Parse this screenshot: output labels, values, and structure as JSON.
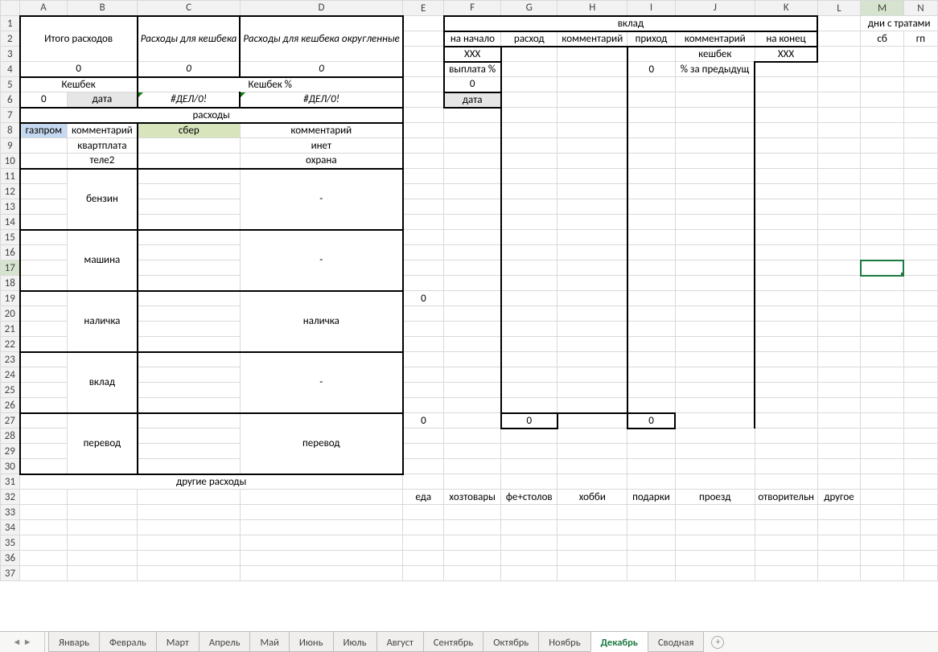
{
  "columns": [
    "A",
    "B",
    "C",
    "D",
    "E",
    "F",
    "G",
    "H",
    "I",
    "J",
    "K",
    "L",
    "M",
    "N"
  ],
  "rows": 37,
  "selected": {
    "col": "M",
    "row": 17
  },
  "cells": {
    "r1": {
      "AB": "Итого расходов",
      "C": "Расходы для кешбека",
      "D": "Расходы для кешбека округленные",
      "H": "вклад",
      "MN": "дни с тратами"
    },
    "r2": {
      "F": "на начало",
      "G": "расход",
      "H": "комментарий",
      "I": "приход",
      "J": "комментарий",
      "K": "на конец",
      "M": "сб",
      "N": "гп"
    },
    "r3": {
      "F": "XXX",
      "J": "кешбек",
      "K": "XXX"
    },
    "r4": {
      "AB": "0",
      "C": "0",
      "D": "0",
      "F": "выплата %",
      "I": "0",
      "J": "% за предыдущ"
    },
    "r5": {
      "AB": "Кешбек",
      "CD": "Кешбек %",
      "F": "0"
    },
    "r6": {
      "A": "0",
      "B": "дата",
      "C": "#ДЕЛ/0!",
      "D": "#ДЕЛ/0!",
      "F": "дата"
    },
    "r7": {
      "AD": "расходы"
    },
    "r8": {
      "A": "газпром",
      "B": "комментарий",
      "C": "сбер",
      "D": "комментарий"
    },
    "r9": {
      "B": "квартплата",
      "D": "инет"
    },
    "r10": {
      "B": "теле2",
      "D": "охрана"
    },
    "r12": {
      "B": "бензин",
      "D": "-"
    },
    "r16": {
      "B": "машина",
      "D": "-"
    },
    "r19": {
      "E": "0"
    },
    "r20": {
      "B": "наличка",
      "D": "наличка"
    },
    "r24": {
      "B": "вклад",
      "D": "-"
    },
    "r27": {
      "E": "0",
      "G": "0",
      "I": "0"
    },
    "r28": {
      "B": "перевод",
      "D": "перевод"
    },
    "r31": {
      "AD": "другие расходы"
    },
    "r32": {
      "E": "еда",
      "F": "хозтовары",
      "G": "фе+столов",
      "H": "хобби",
      "I": "подарки",
      "J": "проезд",
      "K": "отворительн",
      "L": "другое"
    }
  },
  "tabs": [
    "Январь",
    "Февраль",
    "Март",
    "Апрель",
    "Май",
    "Июнь",
    "Июль",
    "Август",
    "Сентябрь",
    "Октябрь",
    "Ноябрь",
    "Декабрь",
    "Сводная"
  ],
  "activeTab": "Декабрь"
}
